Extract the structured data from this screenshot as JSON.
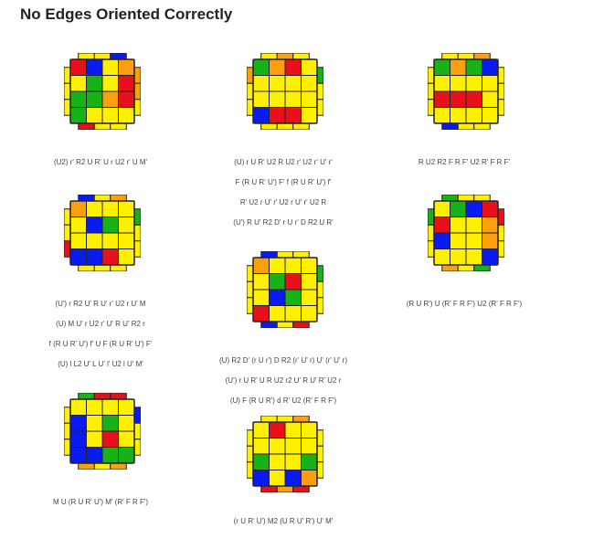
{
  "page": {
    "title": "No Edges Oriented Correctly"
  },
  "colors": {
    "Y": "#ffef00",
    "R": "#e8101a",
    "B": "#0a1bf2",
    "G": "#17b217",
    "O": "#fb9f10",
    "X": "#cfcfcf",
    "outline": "#222222"
  },
  "cases": [
    {
      "face": [
        "RBYO",
        "YGYR",
        "GGOR",
        "GYYY"
      ],
      "top": [
        "Y",
        "Y",
        "B"
      ],
      "right": [
        "O",
        "O",
        "Y"
      ],
      "bottom": [
        "R",
        "Y",
        "Y"
      ],
      "left": [
        "Y",
        "Y",
        "Y"
      ],
      "algs": [
        "(U2) r' R2 U R' U r U2 r' U M'"
      ]
    },
    {
      "face": [
        "GORY",
        "YYYY",
        "YYYY",
        "BRRY"
      ],
      "top": [
        "Y",
        "O",
        "Y"
      ],
      "right": [
        "G",
        "Y",
        "Y"
      ],
      "bottom": [
        "Y",
        "Y",
        "Y"
      ],
      "left": [
        "O",
        "Y",
        "Y"
      ],
      "algs": [
        "(U) r U R' U2 R U2 r' U2 r' U' r'",
        "F (R U R' U') F' f (R U R' U') f'",
        "R' U2 r U' r' U2 r U' r' U2 R",
        "(U') R U' R2 D' r U r' D R2 U R'"
      ]
    },
    {
      "face": [
        "GOGB",
        "YYYY",
        "RRRY",
        "YYYY"
      ],
      "top": [
        "Y",
        "Y",
        "O"
      ],
      "right": [
        "Y",
        "Y",
        "Y"
      ],
      "bottom": [
        "B",
        "Y",
        "Y"
      ],
      "left": [
        "Y",
        "Y",
        "Y"
      ],
      "algs": [
        "R U2 R2 F R F' U2 R' F R F'"
      ]
    },
    {
      "face": [
        "OYYY",
        "YBGY",
        "YYYY",
        "BBRY"
      ],
      "top": [
        "B",
        "Y",
        "O"
      ],
      "right": [
        "G",
        "Y",
        "Y"
      ],
      "bottom": [
        "Y",
        "Y",
        "Y"
      ],
      "left": [
        "Y",
        "Y",
        "R"
      ],
      "algs": [
        "(U') r R2 U' R U' r' U2 r U' M",
        "(U) M U' r U2 r' U' R U' R2 r",
        "f (R U R' U') f' U F (R U R' U') F'",
        "(U) l L2 U' L U' l' U2 l U' M'"
      ]
    },
    {
      "face": [
        "OYYY",
        "YGRY",
        "YBGY",
        "RYYY"
      ],
      "top": [
        "B",
        "Y",
        "Y"
      ],
      "right": [
        "G",
        "Y",
        "Y"
      ],
      "bottom": [
        "B",
        "Y",
        "R"
      ],
      "left": [
        "Y",
        "Y",
        "Y"
      ],
      "algs": [
        "(U) R2 D' (r U r') D R2 (r' U' r) U' (r' U' r)",
        "(U') r U R' U R U2 r2 U' R U' R' U2 r",
        "(U) F (R U R') d R' U2 (R' F R F')"
      ]
    },
    {
      "face": [
        "YGBR",
        "RYYO",
        "BYYO",
        "YYYB"
      ],
      "top": [
        "G",
        "Y",
        "Y"
      ],
      "right": [
        "R",
        "Y",
        "Y"
      ],
      "bottom": [
        "O",
        "Y",
        "G"
      ],
      "left": [
        "G",
        "Y",
        "Y"
      ],
      "algs": [
        "(R U R') U (R' F R F') U2 (R' F R F')"
      ]
    },
    {
      "face": [
        "YYYY",
        "BYGY",
        "BYRY",
        "BBGG"
      ],
      "top": [
        "G",
        "R",
        "R"
      ],
      "right": [
        "B",
        "Y",
        "Y"
      ],
      "bottom": [
        "O",
        "Y",
        "O"
      ],
      "left": [
        "Y",
        "Y",
        "Y"
      ],
      "algs": [
        "M U (R U R' U') M' (R' F R F')"
      ]
    },
    {
      "face": [
        "YRYY",
        "YYYY",
        "GYYG",
        "BYBO"
      ],
      "top": [
        "Y",
        "Y",
        "O"
      ],
      "right": [
        "Y",
        "Y",
        "Y"
      ],
      "bottom": [
        "R",
        "O",
        "R"
      ],
      "left": [
        "Y",
        "Y",
        "Y"
      ],
      "algs": [
        "(r U R' U') M2 (U R U' R') U' M'"
      ]
    }
  ]
}
